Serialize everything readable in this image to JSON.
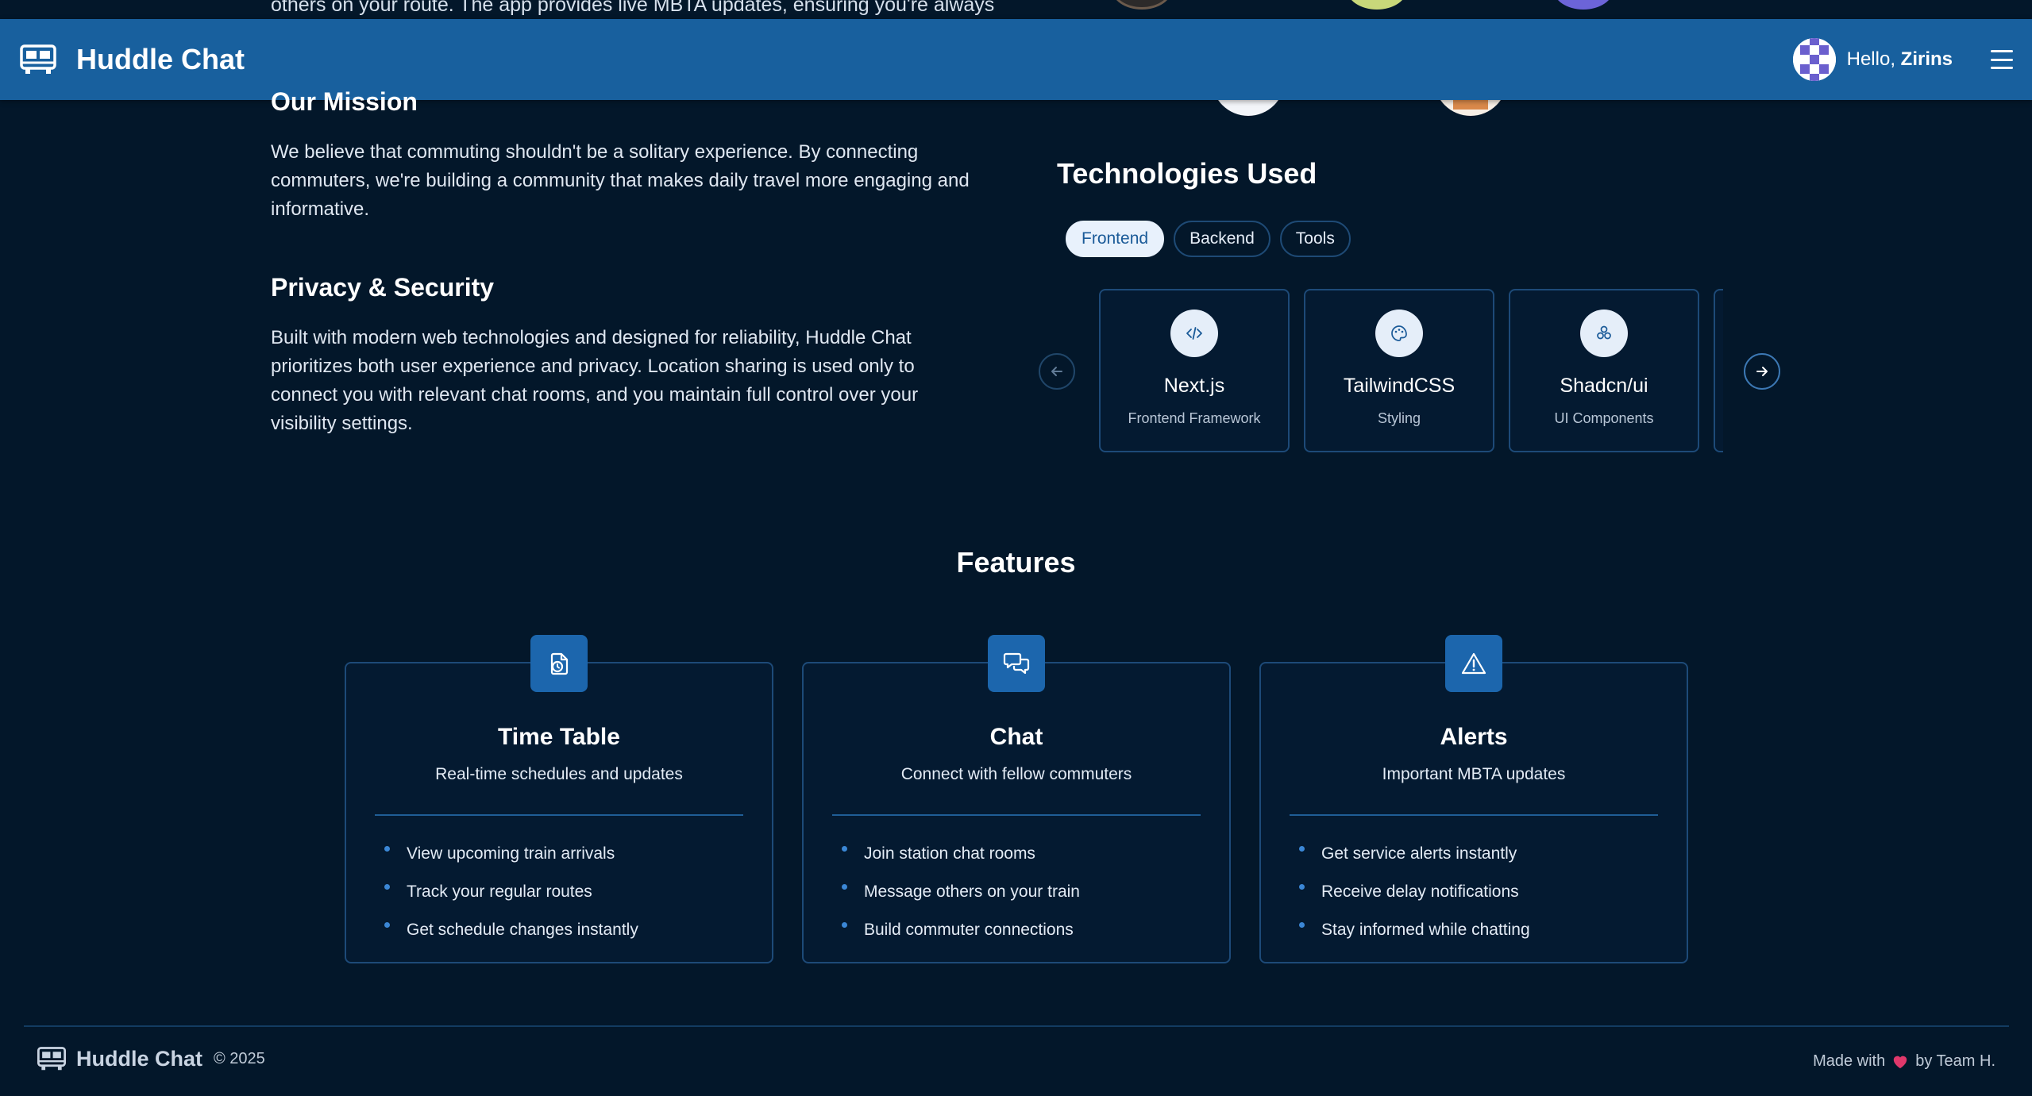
{
  "top": {
    "partial_text": "others on your route. The app provides live MBTA updates, ensuring you're always"
  },
  "header": {
    "brand": "Huddle Chat",
    "greeting_prefix": "Hello,",
    "user_name": "Zirins",
    "accent_color": "#18609e"
  },
  "mission": {
    "heading": "Our Mission",
    "text": "We believe that commuting shouldn't be a solitary experience. By connecting commuters, we're building a community that makes daily travel more engaging and informative."
  },
  "privacy": {
    "heading": "Privacy & Security",
    "text": "Built with modern web technologies and designed for reliability, Huddle Chat prioritizes both user experience and privacy. Location sharing is used only to connect you with relevant chat rooms, and you maintain full control over your visibility settings."
  },
  "technologies": {
    "heading": "Technologies Used",
    "tabs": [
      {
        "label": "Frontend",
        "active": true
      },
      {
        "label": "Backend",
        "active": false
      },
      {
        "label": "Tools",
        "active": false
      }
    ],
    "cards": [
      {
        "name": "Next.js",
        "role": "Frontend Framework",
        "icon": "code-icon"
      },
      {
        "name": "TailwindCSS",
        "role": "Styling",
        "icon": "palette-icon"
      },
      {
        "name": "Shadcn/ui",
        "role": "UI Components",
        "icon": "components-icon"
      },
      {
        "name": "",
        "role": "",
        "icon": ""
      }
    ]
  },
  "features": {
    "heading": "Features",
    "items": [
      {
        "title": "Time Table",
        "subtitle": "Real-time schedules and updates",
        "icon": "clock-file-icon",
        "bullets": [
          "View upcoming train arrivals",
          "Track your regular routes",
          "Get schedule changes instantly"
        ]
      },
      {
        "title": "Chat",
        "subtitle": "Connect with fellow commuters",
        "icon": "chat-bubbles-icon",
        "bullets": [
          "Join station chat rooms",
          "Message others on your train",
          "Build commuter connections"
        ]
      },
      {
        "title": "Alerts",
        "subtitle": "Important MBTA updates",
        "icon": "alert-triangle-icon",
        "bullets": [
          "Get service alerts instantly",
          "Receive delay notifications",
          "Stay informed while chatting"
        ]
      }
    ]
  },
  "footer": {
    "brand": "Huddle Chat",
    "copyright": "© 2025",
    "made_with": "Made with",
    "by": "by Team H.",
    "heart_color": "#e0386b"
  }
}
